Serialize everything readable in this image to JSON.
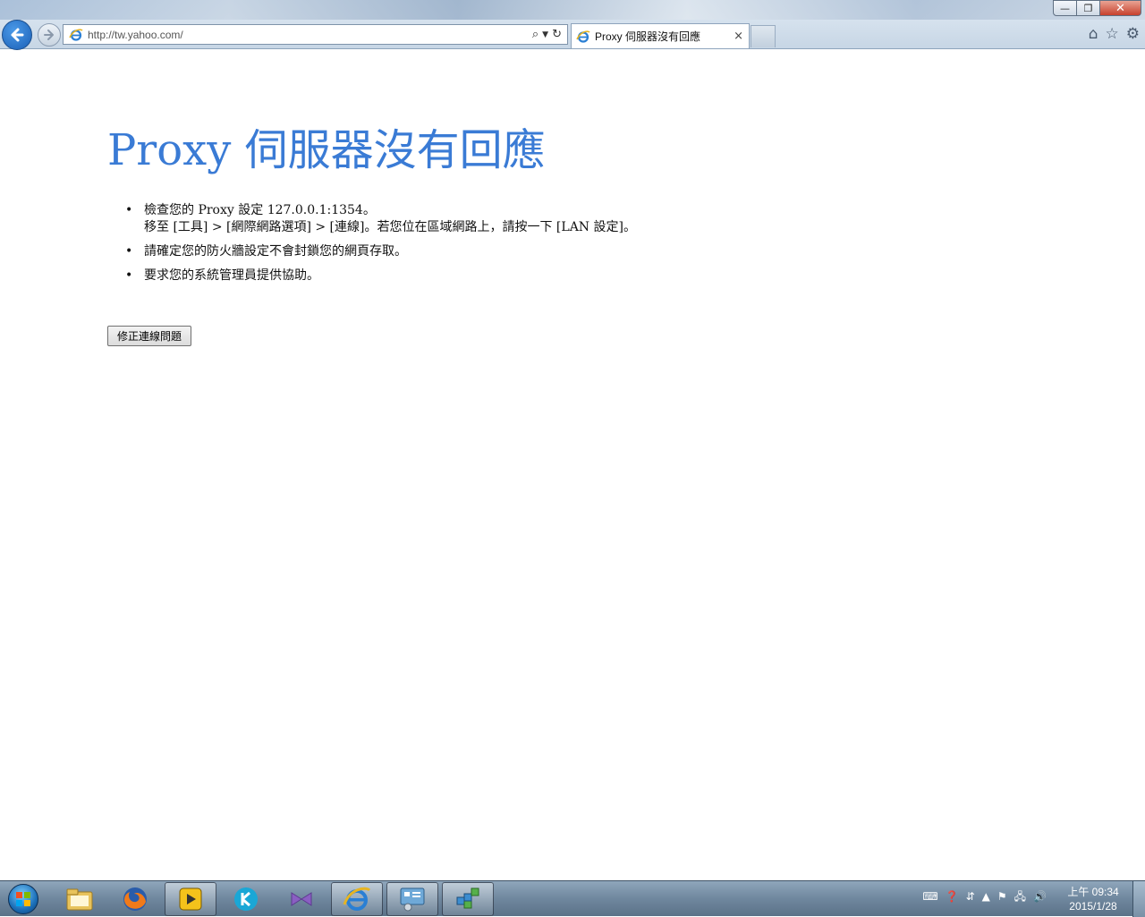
{
  "browser": {
    "window_controls": {
      "minimize": "—",
      "restore": "❐",
      "close": "✕"
    },
    "address": {
      "url": "http://tw.yahoo.com/"
    },
    "tab": {
      "title": "Proxy 伺服器沒有回應",
      "close": "×"
    }
  },
  "error_page": {
    "title": "Proxy 伺服器沒有回應",
    "tips": [
      {
        "lines": [
          "檢查您的 Proxy 設定 127.0.0.1:1354。",
          "移至 [工具] > [網際網路選項] > [連線]。若您位在區域網路上，請按一下 [LAN 設定]。"
        ]
      },
      {
        "lines": [
          "請確定您的防火牆設定不會封鎖您的網頁存取。"
        ]
      },
      {
        "lines": [
          "要求您的系統管理員提供協助。"
        ]
      }
    ],
    "bullet": "•",
    "fix_button": "修正連線問題"
  },
  "taskbar": {
    "pinned": [
      "file-explorer",
      "firefox",
      "potplayer",
      "kkbox",
      "visual-studio",
      "internet-explorer",
      "control-panel",
      "registry-editor"
    ],
    "active": "internet-explorer",
    "clock": {
      "period_time": "上午 09:34",
      "date": "2015/1/28"
    }
  }
}
